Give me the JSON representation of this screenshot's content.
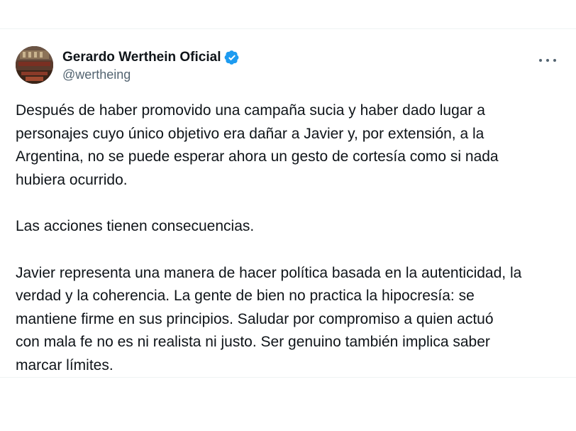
{
  "tweet": {
    "author": {
      "display_name": "Gerardo Werthein Oficial",
      "handle": "@wertheing",
      "verified": true,
      "verified_color": "#1d9bf0"
    },
    "more_icon": "more-horizontal-icon",
    "paragraphs": [
      "Después de haber promovido una campaña sucia y haber dado lugar a\npersonajes cuyo único objetivo era dañar a Javier y, por extensión, a la\nArgentina, no se puede esperar ahora un gesto de cortesía como si nada\nhubiera ocurrido.",
      "Las acciones tienen consecuencias.",
      "Javier representa una manera de hacer política basada en la autenticidad, la\nverdad y la coherencia. La gente de bien no practica la hipocresía: se\nmantiene firme en sus principios. Saludar por compromiso a quien actuó\ncon mala fe no es ni realista ni justo. Ser genuino también implica saber\nmarcar límites."
    ]
  }
}
